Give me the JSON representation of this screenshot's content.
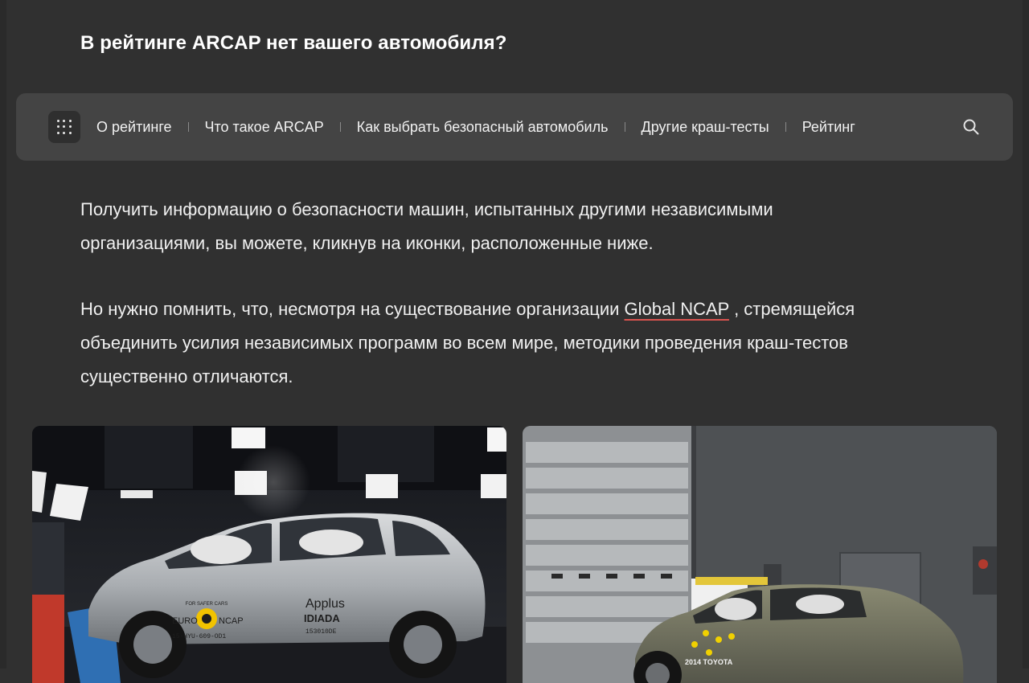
{
  "page": {
    "title": "В рейтинге ARCAP нет вашего автомобиля?"
  },
  "nav": {
    "menu_icon": "grid-dots-icon",
    "search_icon": "search-icon",
    "items": [
      {
        "label": "О рейтинге"
      },
      {
        "label": "Что такое ARCAP"
      },
      {
        "label": "Как выбрать безопасный автомобиль"
      },
      {
        "label": "Другие краш-тесты"
      },
      {
        "label": "Рейтинг"
      }
    ]
  },
  "content": {
    "paragraph1": "Получить информацию о безопасности машин, испытанных другими независимыми организациями, вы можете, кликнув на иконки, расположенные ниже.",
    "paragraph2_before": "Но нужно помнить, что, несмотря на существование организации ",
    "paragraph2_link": "Global NCAP",
    "paragraph2_after": " , стремящейся объединить усилия независимых программ во всем мире, методики проведения краш-тестов существенно отличаются."
  },
  "photos": [
    {
      "labels": {
        "sponsor": "Applus",
        "lab": "IDIADA",
        "logo_left": "EURO",
        "logo_right": "NCAP",
        "logo_top": "FOR SAFER CARS",
        "plate": "15-HYU-609-OD1",
        "code": "153010DE"
      }
    },
    {
      "labels": {
        "plate": "2014 TOYOTA"
      }
    }
  ],
  "colors": {
    "background": "#303030",
    "navbar": "#444444",
    "link_underline": "#d9534f"
  }
}
